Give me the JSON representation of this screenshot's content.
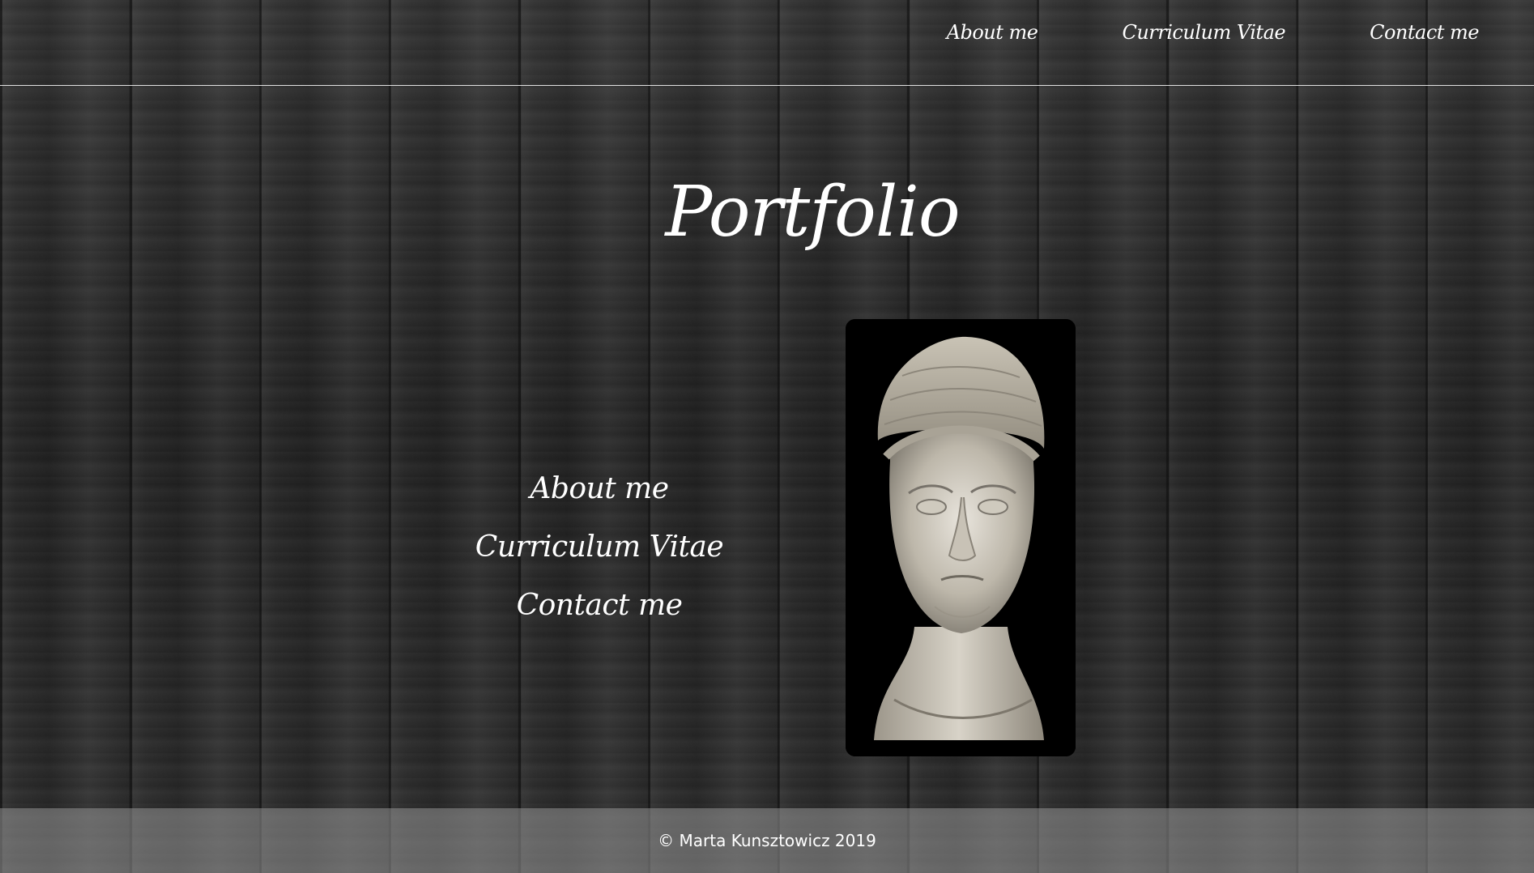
{
  "nav": {
    "items": [
      {
        "label": "About me"
      },
      {
        "label": "Curriculum Vitae"
      },
      {
        "label": "Contact me"
      }
    ]
  },
  "hero": {
    "title": "Portfolio"
  },
  "side_menu": {
    "items": [
      {
        "label": "About me"
      },
      {
        "label": "Curriculum Vitae"
      },
      {
        "label": "Contact me"
      }
    ]
  },
  "portrait": {
    "alt": "Marble bust of a woman"
  },
  "footer": {
    "copyright": "© Marta Kunsztowicz 2019"
  },
  "colors": {
    "text": "#ffffff",
    "background": "#2a2a2a",
    "footer_bg": "#8c8c8c"
  }
}
